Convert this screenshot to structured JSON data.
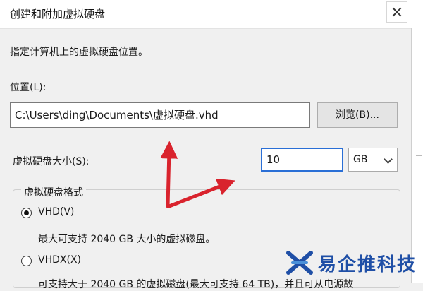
{
  "window": {
    "title": "创建和附加虚拟硬盘"
  },
  "instruction": "指定计算机上的虚拟硬盘位置。",
  "location": {
    "label": "位置(L):",
    "value": "C:\\Users\\ding\\Documents\\虚拟硬盘.vhd",
    "browse_label": "浏览(B)..."
  },
  "size": {
    "label": "虚拟硬盘大小(S):",
    "value": "10",
    "unit": "GB"
  },
  "format": {
    "group_title": "虚拟硬盘格式",
    "options": [
      {
        "label": "VHD(V)",
        "selected": true,
        "description": "最大可支持 2040 GB 大小的虚拟磁盘。"
      },
      {
        "label": "VHDX(X)",
        "selected": false,
        "description": "可支持大于 2040 GB 的虚拟磁盘(最大可支持 64 TB)，并且可从电源故"
      }
    ]
  },
  "watermark": {
    "text": "易企推科技"
  },
  "colors": {
    "annotation_arrow": "#d9232d",
    "focus_border": "#2a6fd6",
    "watermark_blue": "#1f4fa6"
  },
  "icons": {
    "close": "close-icon",
    "dropdown": "chevron-down-icon",
    "watermark_logo": "logo-icon"
  }
}
